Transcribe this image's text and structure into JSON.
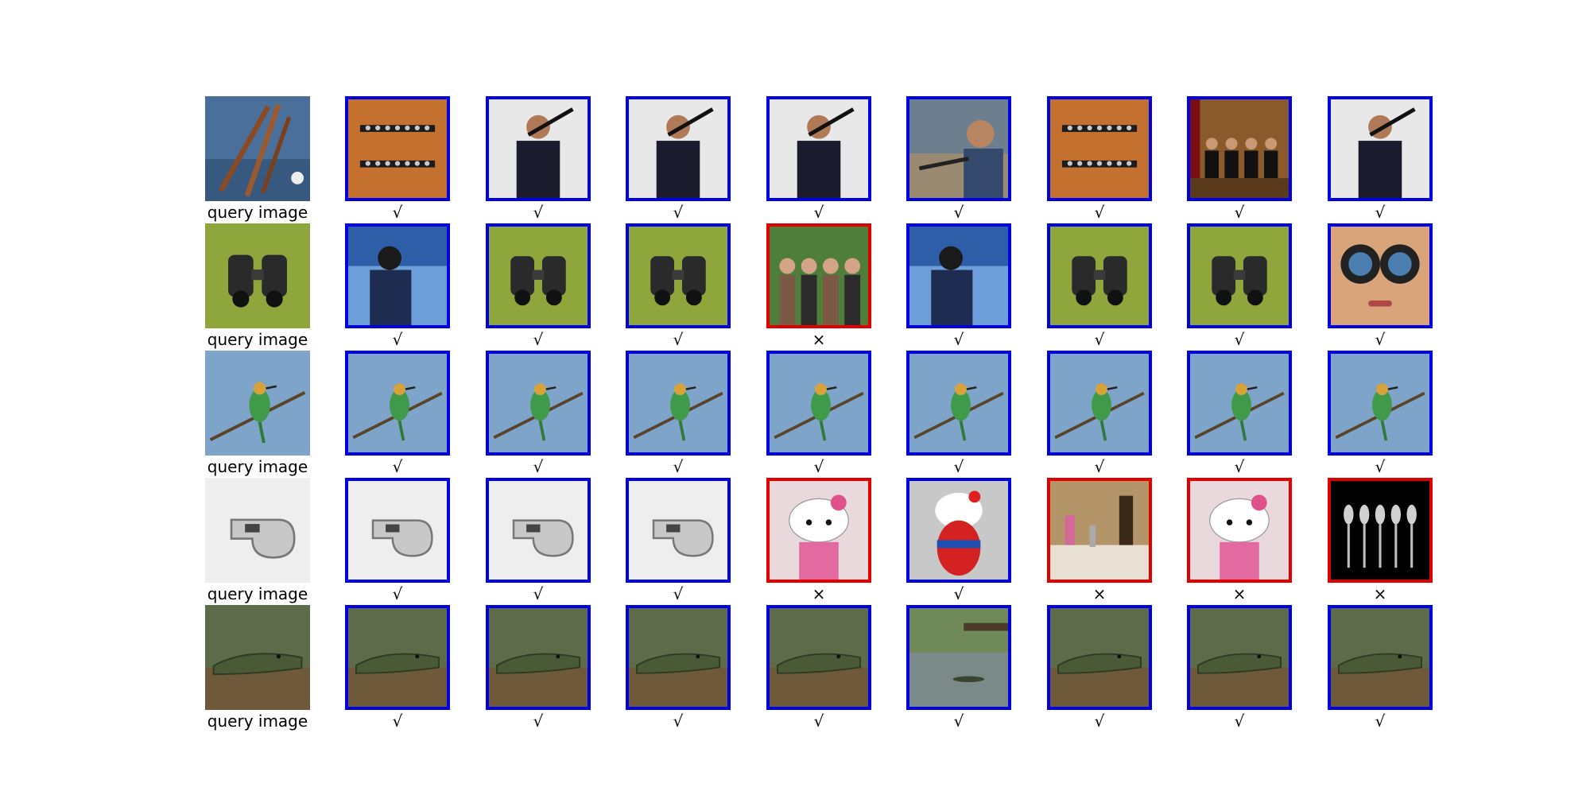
{
  "rows": [
    {
      "query": {
        "caption": "query image",
        "subject": "clarinet-parts"
      },
      "results": [
        {
          "mark": "√",
          "correct": true,
          "subject": "clarinet"
        },
        {
          "mark": "√",
          "correct": true,
          "subject": "clarinet-player"
        },
        {
          "mark": "√",
          "correct": true,
          "subject": "clarinet-player"
        },
        {
          "mark": "√",
          "correct": true,
          "subject": "clarinet-player"
        },
        {
          "mark": "√",
          "correct": true,
          "subject": "clarinet-repair"
        },
        {
          "mark": "√",
          "correct": true,
          "subject": "clarinet"
        },
        {
          "mark": "√",
          "correct": true,
          "subject": "ensemble"
        },
        {
          "mark": "√",
          "correct": true,
          "subject": "clarinet-player"
        }
      ]
    },
    {
      "query": {
        "caption": "query image",
        "subject": "binoculars"
      },
      "results": [
        {
          "mark": "√",
          "correct": true,
          "subject": "binoculars-user"
        },
        {
          "mark": "√",
          "correct": true,
          "subject": "binoculars"
        },
        {
          "mark": "√",
          "correct": true,
          "subject": "binoculars"
        },
        {
          "mark": "×",
          "correct": false,
          "subject": "people-group"
        },
        {
          "mark": "√",
          "correct": true,
          "subject": "binoculars-user"
        },
        {
          "mark": "√",
          "correct": true,
          "subject": "binoculars"
        },
        {
          "mark": "√",
          "correct": true,
          "subject": "binoculars"
        },
        {
          "mark": "√",
          "correct": true,
          "subject": "binoculars-face"
        }
      ]
    },
    {
      "query": {
        "caption": "query image",
        "subject": "bee-eater"
      },
      "results": [
        {
          "mark": "√",
          "correct": true,
          "subject": "bee-eater"
        },
        {
          "mark": "√",
          "correct": true,
          "subject": "bee-eater"
        },
        {
          "mark": "√",
          "correct": true,
          "subject": "bee-eater"
        },
        {
          "mark": "√",
          "correct": true,
          "subject": "bee-eater"
        },
        {
          "mark": "√",
          "correct": true,
          "subject": "bee-eater"
        },
        {
          "mark": "√",
          "correct": true,
          "subject": "bee-eater"
        },
        {
          "mark": "√",
          "correct": true,
          "subject": "bee-eater"
        },
        {
          "mark": "√",
          "correct": true,
          "subject": "bee-eater"
        }
      ]
    },
    {
      "query": {
        "caption": "query image",
        "subject": "whistle"
      },
      "results": [
        {
          "mark": "√",
          "correct": true,
          "subject": "whistle"
        },
        {
          "mark": "√",
          "correct": true,
          "subject": "whistle"
        },
        {
          "mark": "√",
          "correct": true,
          "subject": "whistle"
        },
        {
          "mark": "×",
          "correct": false,
          "subject": "hello-kitty"
        },
        {
          "mark": "√",
          "correct": true,
          "subject": "hello-kitty-whistle"
        },
        {
          "mark": "×",
          "correct": false,
          "subject": "sink-toiletries"
        },
        {
          "mark": "×",
          "correct": false,
          "subject": "hello-kitty"
        },
        {
          "mark": "×",
          "correct": false,
          "subject": "spoons"
        }
      ]
    },
    {
      "query": {
        "caption": "query image",
        "subject": "crocodile"
      },
      "results": [
        {
          "mark": "√",
          "correct": true,
          "subject": "crocodile"
        },
        {
          "mark": "√",
          "correct": true,
          "subject": "crocodile"
        },
        {
          "mark": "√",
          "correct": true,
          "subject": "crocodile"
        },
        {
          "mark": "√",
          "correct": true,
          "subject": "crocodile"
        },
        {
          "mark": "√",
          "correct": true,
          "subject": "crocodile-pond"
        },
        {
          "mark": "√",
          "correct": true,
          "subject": "crocodile"
        },
        {
          "mark": "√",
          "correct": true,
          "subject": "crocodile"
        },
        {
          "mark": "√",
          "correct": true,
          "subject": "crocodile"
        }
      ]
    }
  ],
  "colors": {
    "correct_border": "#0000e0",
    "wrong_border": "#e00000"
  }
}
